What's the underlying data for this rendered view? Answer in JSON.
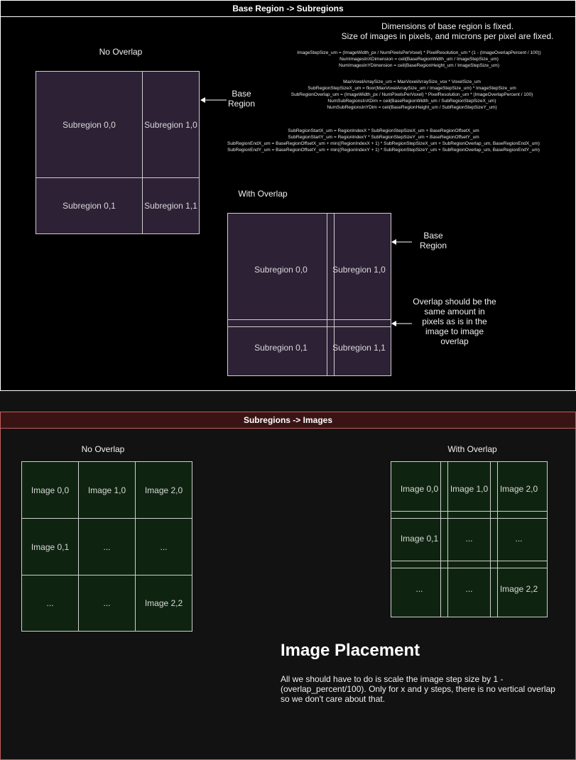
{
  "top_panel": {
    "title": "Base Region -> Subregions",
    "fixed_note": [
      "Dimensions of base region is fixed.",
      "Size of images in pixels, and microns per pixel are fixed."
    ],
    "no_overlap_label": "No Overlap",
    "with_overlap_label": "With Overlap",
    "base_region_label_1": [
      "Base",
      "Region"
    ],
    "base_region_label_2": [
      "Base",
      "Region"
    ],
    "overlap_note": [
      "Overlap should be the",
      "same amount in",
      "pixels as is in the",
      "image to image",
      "overlap"
    ],
    "formulas_1": [
      "ImageStepSize_um = (ImageWidth_px / NumPixelsPerVoxel) * PixelResolution_um * (1 - (ImageOverlapPercent / 100))",
      "NumImagesInXDimension = ceil(BaseRegionWidth_um / ImageStepSize_um)",
      "NumImagesInYDimension = ceil(BaseRegionHeight_um / ImageStepSize_um)"
    ],
    "formulas_2": [
      "MaxVoxelArraySize_um = MaxVoxelArraySize_vox * VoxelSize_um",
      "SubRegionStepSizeX_um = floor(MaxVoxelArraySize_um / ImageStepSize_um) * ImageStepSize_um",
      "SubRegionOverlap_um = (ImageWidth_px / NumPixelsPerVoxel) * PixelResolution_um * (ImageOverlapPercent / 100)",
      "NumSubRegionsInXDim = ceil(BaseRegionWidth_um / SubRegionStepSizeX_um)",
      "NumSubRegionsInYDim = ceil(BaseRegionHeight_um / SubRegionStepSizeY_um)"
    ],
    "formulas_3": [
      "SubRegionStartX_um = RegionIndexX * SubRegionStepSizeX_um + BaseRegionOffsetX_um",
      "SubRegionStartY_um = RegionIndexY * SubRegionStepSizeY_um + BaseRegionOffsetY_um",
      "SubRegionEndX_um = BaseRegionOffsetX_um + min((RegionIndexX + 1) * SubRegionStepSizeX_um + SubRegionOverlap_um, BaseRegionEndX_um)",
      "SubRegionEndY_um = BaseRegionOffsetY_um + min((RegionIndexY + 1) * SubRegionStepSizeY_um + SubRegionOverlap_um, BaseRegionEndY_um)"
    ],
    "no_overlap_cells": [
      "Subregion 0,0",
      "Subregion 1,0",
      "Subregion 0,1",
      "Subregion 1,1"
    ],
    "with_overlap_cells": [
      "Subregion 0,0",
      "Subregion 1,0",
      "Subregion 0,1",
      "Subregion 1,1"
    ]
  },
  "bottom_panel": {
    "title": "Subregions -> Images",
    "no_overlap_label": "No Overlap",
    "with_overlap_label": "With Overlap",
    "no_overlap_cells": [
      "Image 0,0",
      "Image 1,0",
      "Image 2,0",
      "Image 0,1",
      "...",
      "...",
      "...",
      "...",
      "Image 2,2"
    ],
    "with_overlap_cells": [
      "Image 0,0",
      "Image 1,0",
      "Image 2,0",
      "Image 0,1",
      "...",
      "...",
      "...",
      "...",
      "Image 2,2"
    ],
    "placement_title": "Image Placement",
    "placement_text": "All we should have to do is scale the image step size by 1 - (overlap_percent/100). Only for x and y steps, there is no vertical overlap so we don't care about that."
  },
  "colors": {
    "top_title_bg": "#000000",
    "bottom_title_bg": "#3a1414",
    "bottom_border": "#c06060",
    "subregion_fill": "#2d2136",
    "image_fill": "#0f2410"
  }
}
